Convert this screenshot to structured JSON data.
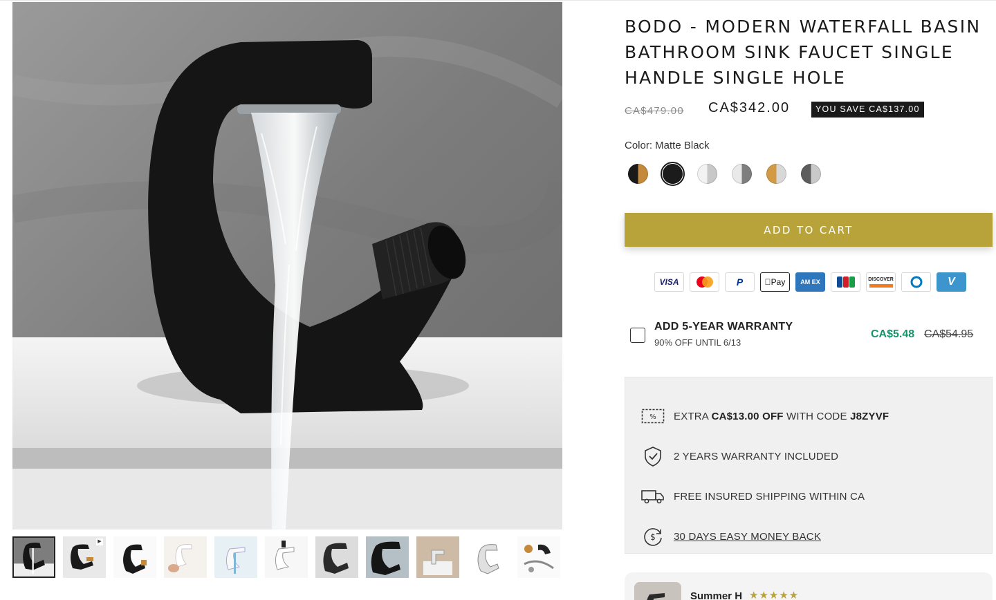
{
  "product": {
    "title": "BODO - MODERN WATERFALL BASIN BATHROOM SINK FAUCET SINGLE HANDLE SINGLE HOLE",
    "old_price": "CA$479.00",
    "new_price": "CA$342.00",
    "save_badge": "YOU SAVE CA$137.00",
    "color_label": "Color: Matte Black",
    "selected_color_index": 1,
    "swatches": [
      {
        "name": "black-gold",
        "colors": [
          "#1a1a1a",
          "#c4893a"
        ]
      },
      {
        "name": "matte-black",
        "colors": [
          "#1b1b1b",
          "#1b1b1b"
        ]
      },
      {
        "name": "white-chrome",
        "colors": [
          "#f2f2f2",
          "#c8c8c8"
        ]
      },
      {
        "name": "chrome",
        "colors": [
          "#e9e9e9",
          "#7e7e7e"
        ]
      },
      {
        "name": "gold-chrome",
        "colors": [
          "#d39a45",
          "#d8d8d8"
        ]
      },
      {
        "name": "gunmetal",
        "colors": [
          "#5c5c5c",
          "#c9c9c9"
        ]
      }
    ],
    "add_to_cart": "ADD TO CART"
  },
  "payments": [
    "VISA",
    "Mastercard",
    "PayPal",
    "Apple Pay",
    "Amex",
    "JCB",
    "DISCOVER",
    "Diners",
    "Venmo"
  ],
  "warranty": {
    "title": "ADD 5-YEAR WARRANTY",
    "subtitle": "90% OFF UNTIL 6/13",
    "price": "CA$5.48",
    "old_price": "CA$54.95"
  },
  "perks": {
    "code_prefix": "EXTRA",
    "code_amount": "CA$13.00 OFF",
    "code_middle": "WITH CODE",
    "code": "J8ZYVF",
    "warranty": "2 YEARS WARRANTY INCLUDED",
    "shipping": "FREE INSURED SHIPPING WITHIN CA",
    "money_back": "30 DAYS EASY MONEY BACK"
  },
  "review": {
    "name": "Summer H",
    "stars": "★★★★★"
  },
  "colors": {
    "accent": "#b8a33a",
    "green": "#17936b",
    "dark": "#1a1a1a"
  }
}
